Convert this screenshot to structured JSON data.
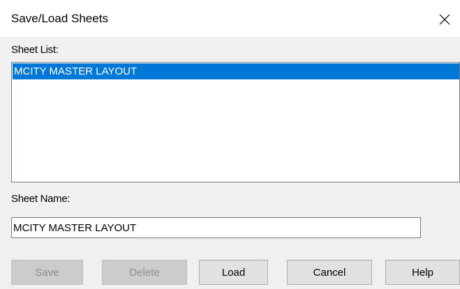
{
  "window": {
    "title": "Save/Load Sheets",
    "close_icon": "close-icon"
  },
  "sheet_list": {
    "label": "Sheet List:",
    "items": [
      {
        "label": "MCITY MASTER LAYOUT",
        "selected": true
      }
    ]
  },
  "sheet_name": {
    "label": "Sheet Name:",
    "value": "MCITY MASTER LAYOUT"
  },
  "buttons": {
    "save": {
      "label": "Save",
      "enabled": false
    },
    "delete": {
      "label": "Delete",
      "enabled": false
    },
    "load": {
      "label": "Load",
      "enabled": true
    },
    "cancel": {
      "label": "Cancel",
      "enabled": true
    },
    "help": {
      "label": "Help",
      "enabled": true
    }
  },
  "colors": {
    "selection": "#0078d7",
    "dialog_bg": "#f0f0f0",
    "titlebar_bg": "#ffffff"
  }
}
